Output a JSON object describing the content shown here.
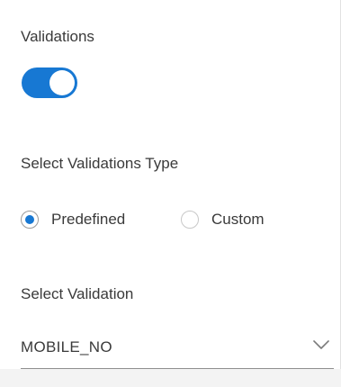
{
  "validations": {
    "label": "Validations",
    "enabled": true
  },
  "validation_type": {
    "label": "Select Validations Type",
    "options": [
      {
        "label": "Predefined",
        "selected": true
      },
      {
        "label": "Custom",
        "selected": false
      }
    ]
  },
  "validation_select": {
    "label": "Select Validation",
    "value": "MOBILE_NO",
    "icon": "chevron-down-icon"
  },
  "colors": {
    "accent": "#1778d3",
    "text": "#3a3a3a"
  }
}
